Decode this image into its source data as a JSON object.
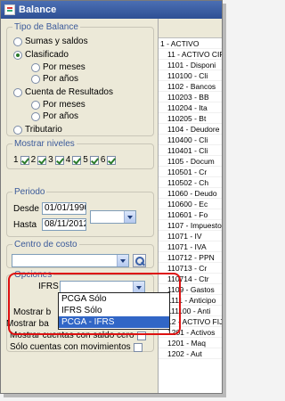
{
  "window": {
    "title": "Balance"
  },
  "tipo": {
    "legend": "Tipo de Balance",
    "options": [
      "Sumas y saldos",
      "Clasificado",
      "Por meses",
      "Por años",
      "Cuenta de Resultados",
      "Por meses",
      "Por años",
      "Tributario"
    ]
  },
  "niveles": {
    "legend": "Mostrar niveles",
    "items": [
      "1",
      "2",
      "3",
      "4",
      "5",
      "6"
    ]
  },
  "periodo": {
    "legend": "Periodo",
    "desde_label": "Desde",
    "desde_value": "01/01/1990",
    "hasta_label": "Hasta",
    "hasta_value": "08/11/2012"
  },
  "centro": {
    "legend": "Centro de costo"
  },
  "opciones": {
    "legend": "Opciones",
    "ifrs_label": "IFRS",
    "mostrar_b1": "Mostrar b",
    "mostrar_b2": "Mostrar ba",
    "saldo_cero": "Mostrar cuentas con saldo cero",
    "con_movimientos": "Sólo cuentas con movimientos",
    "dropdown_options": [
      "PCGA Sólo",
      "IFRS Sólo",
      "PCGA - IFRS"
    ],
    "selected_option": "PCGA - IFRS"
  },
  "tree": {
    "rows": [
      "1 - ACTIVO",
      "11 - ACTIVO CIR",
      "1101 - Disponi",
      "110100 - Cli",
      "1102 - Bancos",
      "110203 - BB",
      "110204 - Ita",
      "110205 - Bt",
      "1104 - Deudore",
      "110400 - Cli",
      "110401 - Cli",
      "1105 - Docum",
      "110501 - Cr",
      "110502 - Ch",
      "11060 - Deudo",
      "110600 - Ec",
      "110601 - Fo",
      "1107 - Impuesto",
      "11071 - IV",
      "11071 - IVA",
      "110712 - PPN",
      "110713 - Cr",
      "110714 - Ctr",
      "1109 - Gastos",
      "1111 - Anticipo",
      "111100 - Anti",
      "12 - ACTIVO FIJO",
      "1201 - Activos",
      "1201 - Maq",
      "1202 - Aut"
    ]
  }
}
